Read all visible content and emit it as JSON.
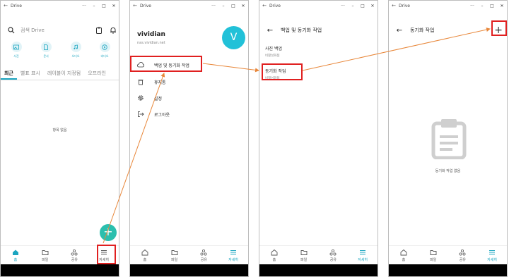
{
  "app_title": "Drive",
  "window_controls": {
    "menu": "···",
    "minimize": "–",
    "maximize": "□",
    "close": "✕"
  },
  "home": {
    "search_placeholder": "검색 Drive",
    "quick": [
      "사진",
      "문서",
      "오디오",
      "비디오"
    ],
    "tabs": [
      "최근",
      "별표 표시",
      "레이블이 지정됨",
      "오프라인"
    ],
    "empty": "항목 없음",
    "fab": "+"
  },
  "nav": [
    "홈",
    "파일",
    "공유",
    "자세히"
  ],
  "account": {
    "name": "vividian",
    "host": "nas.vividian.net",
    "avatar_letter": "V",
    "menu": [
      "백업 및 동기화 작업",
      "휴지통",
      "설정",
      "로그아웃"
    ]
  },
  "backup": {
    "title": "백업 및 동기화 작업",
    "photo_title": "사진 백업",
    "photo_status": "비활성화됨",
    "sync_title": "동기화 작업",
    "sync_status": "비활성화됨"
  },
  "sync": {
    "title": "동기화 작업",
    "add": "+",
    "empty": "동기화 작업 없음"
  },
  "colors": {
    "accent": "#1aa5c0",
    "highlight": "#e02020",
    "arrow": "#e8873a"
  }
}
